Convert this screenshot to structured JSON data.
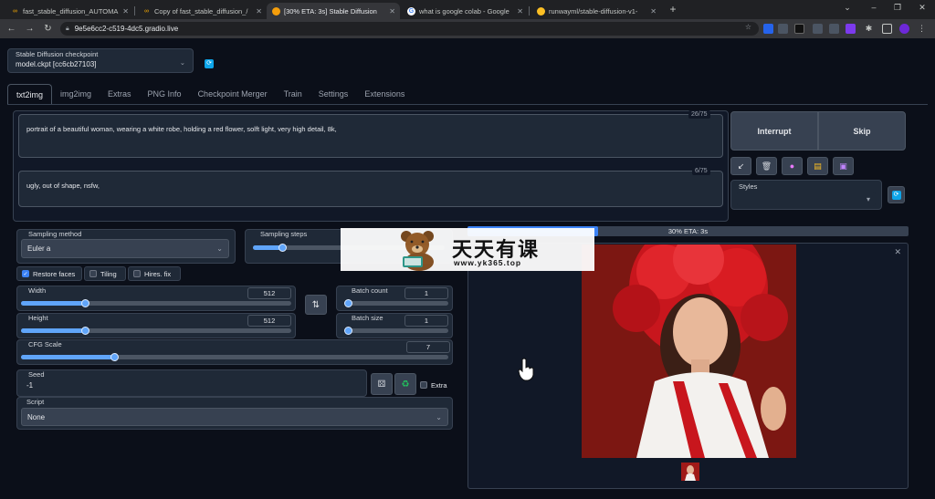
{
  "browser": {
    "tabs": [
      {
        "label": "fast_stable_diffusion_AUTOMA",
        "active": false
      },
      {
        "label": "Copy of fast_stable_diffusion_/",
        "active": false
      },
      {
        "label": "[30% ETA: 3s] Stable Diffusion",
        "active": true
      },
      {
        "label": "what is google colab - Google",
        "active": false
      },
      {
        "label": "runwayml/stable-diffusion-v1-",
        "active": false
      }
    ],
    "url": "9e5e6cc2-c519-4dc5.gradio.live"
  },
  "checkpoint": {
    "label": "Stable Diffusion checkpoint",
    "value": "model.ckpt [cc6cb27103]"
  },
  "tabs": [
    "txt2img",
    "img2img",
    "Extras",
    "PNG Info",
    "Checkpoint Merger",
    "Train",
    "Settings",
    "Extensions"
  ],
  "prompt": {
    "text": "portrait of a beautiful woman, wearing a white robe, holding a red flower, solft light, very high detail, 8k,",
    "counter": "26/75"
  },
  "negative_prompt": {
    "text": "ugly, out of shape, nsfw,",
    "counter": "6/75"
  },
  "actions": {
    "interrupt": "Interrupt",
    "skip": "Skip",
    "styles_label": "Styles"
  },
  "sampling": {
    "method_label": "Sampling method",
    "method_value": "Euler a",
    "steps_label": "Sampling steps"
  },
  "options": {
    "restore_faces": "Restore faces",
    "tiling": "Tiling",
    "hires_fix": "Hires. fix",
    "restore_faces_checked": true
  },
  "size": {
    "width_label": "Width",
    "width_value": "512",
    "height_label": "Height",
    "height_value": "512"
  },
  "batch": {
    "count_label": "Batch count",
    "count_value": "1",
    "size_label": "Batch size",
    "size_value": "1"
  },
  "cfg": {
    "label": "CFG Scale",
    "value": "7"
  },
  "seed": {
    "label": "Seed",
    "value": "-1",
    "extra": "Extra"
  },
  "script": {
    "label": "Script",
    "value": "None"
  },
  "progress": {
    "text": "30% ETA: 3s",
    "percent": 30
  },
  "watermark": {
    "title": "天天有课",
    "url": "www.yk365.top"
  },
  "colors": {
    "accent": "#3b82f6",
    "background": "#0b0f19",
    "panel": "#1f2937"
  }
}
